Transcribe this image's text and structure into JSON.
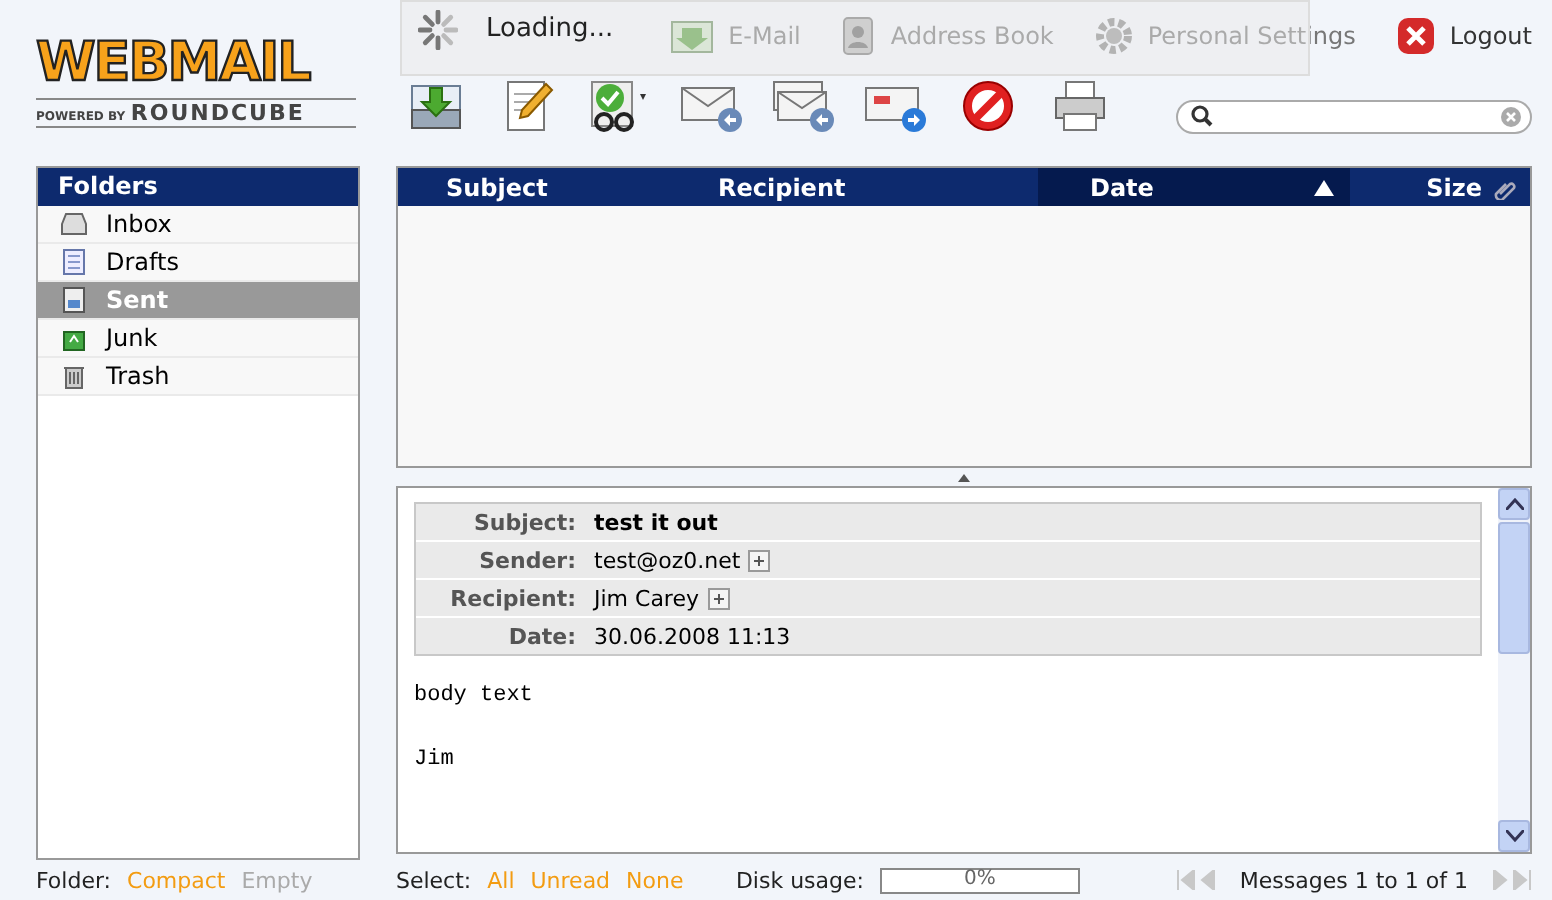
{
  "logo": {
    "title": "WEBMAIL",
    "powered": "POWERED BY",
    "brand": "ROUNDCUBE"
  },
  "loading": {
    "text": "Loading..."
  },
  "nav": [
    {
      "label": "E-Mail",
      "kind": "mail"
    },
    {
      "label": "Address Book",
      "kind": "book"
    },
    {
      "label": "Personal Settings",
      "kind": "settings"
    },
    {
      "label": "Logout",
      "kind": "logout"
    }
  ],
  "toolbar": [
    {
      "kind": "check-mail"
    },
    {
      "kind": "compose"
    },
    {
      "kind": "mark"
    },
    {
      "kind": "reply"
    },
    {
      "kind": "reply-all"
    },
    {
      "kind": "forward"
    },
    {
      "kind": "delete"
    },
    {
      "kind": "print"
    }
  ],
  "folders": {
    "title": "Folders",
    "items": [
      {
        "label": "Inbox",
        "kind": "inbox",
        "selected": false
      },
      {
        "label": "Drafts",
        "kind": "drafts",
        "selected": false
      },
      {
        "label": "Sent",
        "kind": "sent",
        "selected": true
      },
      {
        "label": "Junk",
        "kind": "junk",
        "selected": false
      },
      {
        "label": "Trash",
        "kind": "trash",
        "selected": false
      }
    ]
  },
  "list": {
    "columns": [
      {
        "label": "Subject",
        "sorted": false,
        "kind": "subject"
      },
      {
        "label": "Recipient",
        "sorted": false,
        "kind": "recipient"
      },
      {
        "label": "Date",
        "sorted": true,
        "kind": "date"
      },
      {
        "label": "Size",
        "sorted": false,
        "kind": "size"
      }
    ]
  },
  "preview": {
    "headers": [
      {
        "label": "Subject:",
        "value": "test it out",
        "kind": "subject"
      },
      {
        "label": "Sender:",
        "value": "test@oz0.net",
        "kind": "address"
      },
      {
        "label": "Recipient:",
        "value": "Jim Carey",
        "kind": "address"
      },
      {
        "label": "Date:",
        "value": "30.06.2008 11:13",
        "kind": "date"
      }
    ],
    "body": "body text\n\nJim"
  },
  "footer": {
    "folder_label": "Folder:",
    "folder_actions": [
      {
        "label": "Compact",
        "disabled": false
      },
      {
        "label": "Empty",
        "disabled": true
      }
    ],
    "select_label": "Select:",
    "select_actions": [
      "All",
      "Unread",
      "None"
    ],
    "disk_label": "Disk usage:",
    "disk": {
      "level": 0,
      "reading": "0%"
    },
    "pager_text": "Messages 1 to 1 of 1"
  }
}
